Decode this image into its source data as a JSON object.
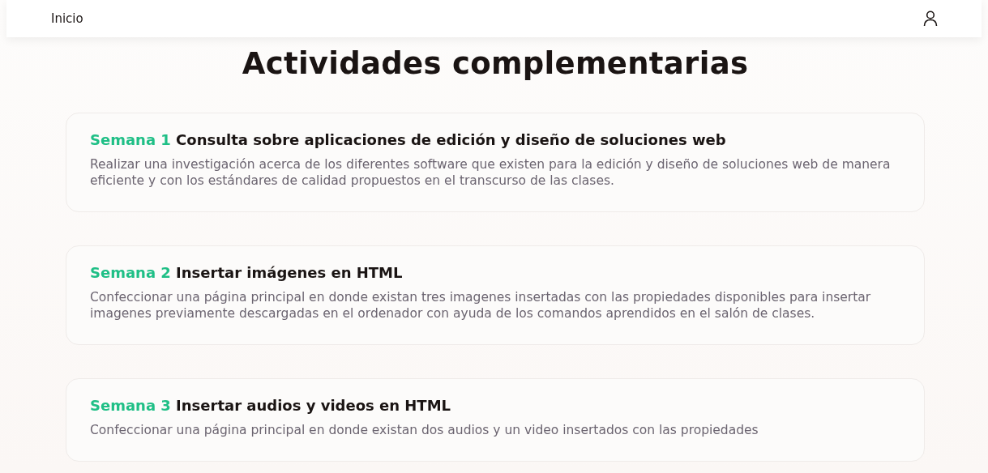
{
  "nav": {
    "home_link": "Inicio"
  },
  "page_title": "Actividades complementarias",
  "activities": [
    {
      "week": "Semana 1",
      "title": "Consulta sobre aplicaciones de edición y diseño de soluciones web",
      "description": "Realizar una investigación acerca de los diferentes software que existen para la edición y diseño de soluciones web de manera eficiente y con los estándares de calidad propuestos en el transcurso de las clases."
    },
    {
      "week": "Semana 2",
      "title": "Insertar imágenes en HTML",
      "description": "Confeccionar una página principal en donde existan tres imagenes insertadas con las propiedades disponibles para insertar imagenes previamente descargadas en el ordenador con ayuda de los comandos aprendidos en el salón de clases."
    },
    {
      "week": "Semana 3",
      "title": "Insertar audios y videos en HTML",
      "description": "Confeccionar una página principal en donde existan dos audios y un video insertados con las propiedades"
    }
  ]
}
